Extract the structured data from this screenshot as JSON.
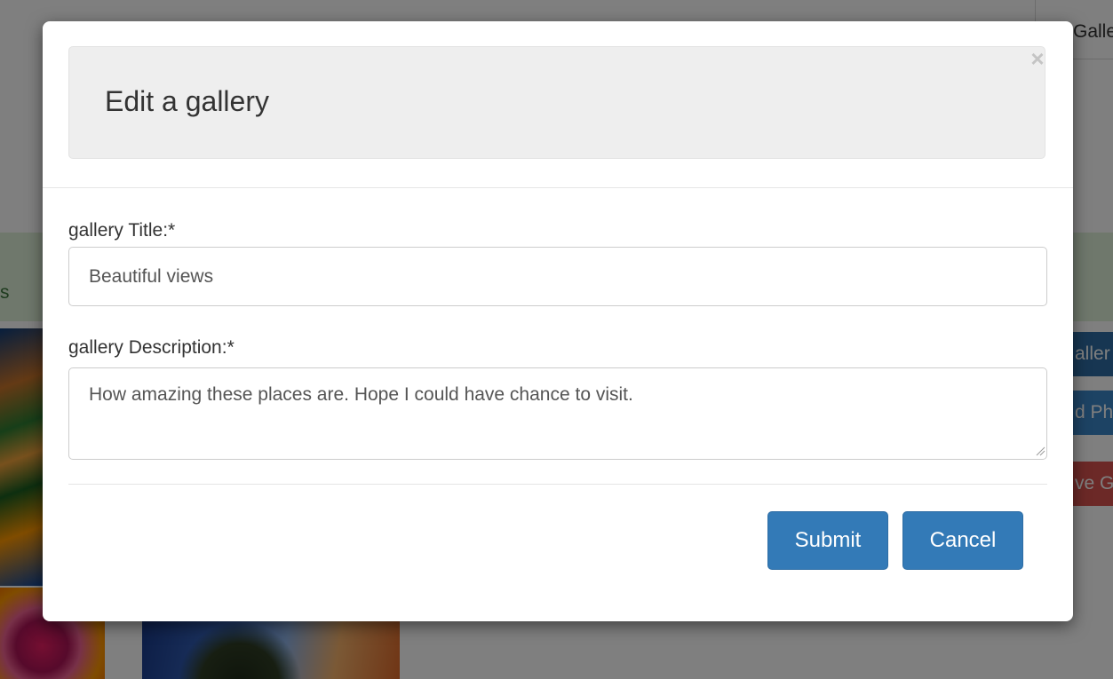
{
  "background": {
    "top_right_text": "Galle",
    "green_band_text": "s",
    "side_buttons": [
      "aller",
      "d Ph",
      "ve G"
    ]
  },
  "modal": {
    "title": "Edit a gallery",
    "close_symbol": "×",
    "fields": {
      "title": {
        "label": "gallery Title:*",
        "value": "Beautiful views"
      },
      "description": {
        "label": "gallery Description:*",
        "value": "How amazing these places are. Hope I could have chance to visit."
      }
    },
    "buttons": {
      "submit": "Submit",
      "cancel": "Cancel"
    }
  },
  "colors": {
    "primary": "#337ab7",
    "danger": "#d9534f",
    "success_bg": "#dff0d8",
    "overlay": "rgba(0,0,0,0.5)"
  },
  "icons": {
    "close": "close-icon",
    "resize": "resize-grip-icon"
  }
}
